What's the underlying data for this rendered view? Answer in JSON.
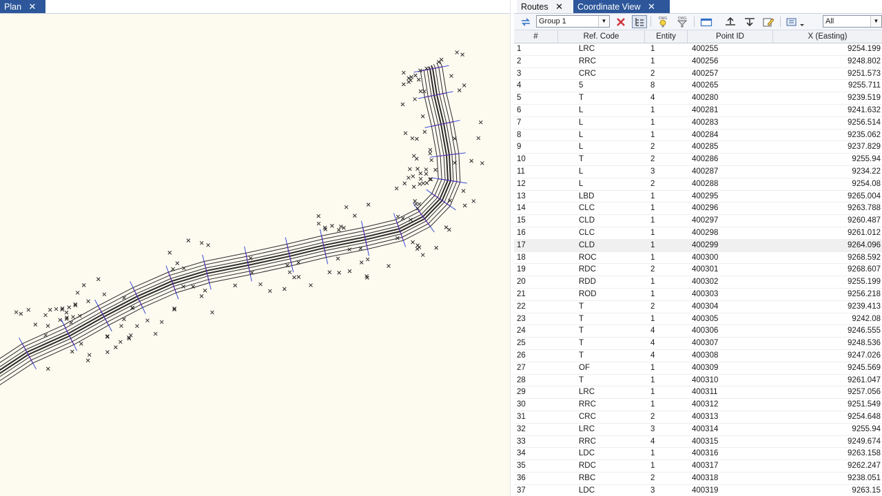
{
  "plan": {
    "tab_label": "Plan",
    "tab_close": "✕"
  },
  "coord": {
    "tabs": [
      {
        "label": "Routes",
        "close": "✕"
      },
      {
        "label": "Coordinate View",
        "close": "✕"
      }
    ],
    "toolbar": {
      "group_value": "Group 1",
      "filter_value": "All",
      "dwg_label": "DWG"
    },
    "columns": [
      "#",
      "Ref. Code",
      "Entity",
      "Point ID",
      "X (Easting)"
    ],
    "rows": [
      [
        "1",
        "LRC",
        "1",
        "400255",
        "9254.199"
      ],
      [
        "2",
        "RRC",
        "1",
        "400256",
        "9248.802"
      ],
      [
        "3",
        "CRC",
        "2",
        "400257",
        "9251.573"
      ],
      [
        "4",
        "5",
        "8",
        "400265",
        "9255.711"
      ],
      [
        "5",
        "T",
        "4",
        "400280",
        "9239.519"
      ],
      [
        "6",
        "L",
        "1",
        "400281",
        "9241.632"
      ],
      [
        "7",
        "L",
        "1",
        "400283",
        "9256.514"
      ],
      [
        "8",
        "L",
        "1",
        "400284",
        "9235.062"
      ],
      [
        "9",
        "L",
        "2",
        "400285",
        "9237.829"
      ],
      [
        "10",
        "T",
        "2",
        "400286",
        "9255.94"
      ],
      [
        "11",
        "L",
        "3",
        "400287",
        "9234.22"
      ],
      [
        "12",
        "L",
        "2",
        "400288",
        "9254.08"
      ],
      [
        "13",
        "LBD",
        "1",
        "400295",
        "9265.004"
      ],
      [
        "14",
        "CLC",
        "1",
        "400296",
        "9263.788"
      ],
      [
        "15",
        "CLD",
        "1",
        "400297",
        "9260.487"
      ],
      [
        "16",
        "CLC",
        "1",
        "400298",
        "9261.012"
      ],
      [
        "17",
        "CLD",
        "1",
        "400299",
        "9264.096"
      ],
      [
        "18",
        "ROC",
        "1",
        "400300",
        "9268.592"
      ],
      [
        "19",
        "RDC",
        "2",
        "400301",
        "9268.607"
      ],
      [
        "20",
        "RDD",
        "1",
        "400302",
        "9255.199"
      ],
      [
        "21",
        "ROD",
        "1",
        "400303",
        "9256.218"
      ],
      [
        "22",
        "T",
        "2",
        "400304",
        "9239.413"
      ],
      [
        "23",
        "T",
        "1",
        "400305",
        "9242.08"
      ],
      [
        "24",
        "T",
        "4",
        "400306",
        "9246.555"
      ],
      [
        "25",
        "T",
        "4",
        "400307",
        "9248.536"
      ],
      [
        "26",
        "T",
        "4",
        "400308",
        "9247.026"
      ],
      [
        "27",
        "OF",
        "1",
        "400309",
        "9245.569"
      ],
      [
        "28",
        "T",
        "1",
        "400310",
        "9261.047"
      ],
      [
        "29",
        "LRC",
        "1",
        "400311",
        "9257.056"
      ],
      [
        "30",
        "RRC",
        "1",
        "400312",
        "9251.549"
      ],
      [
        "31",
        "CRC",
        "2",
        "400313",
        "9254.648"
      ],
      [
        "32",
        "LRC",
        "3",
        "400314",
        "9255.94"
      ],
      [
        "33",
        "RRC",
        "4",
        "400315",
        "9249.674"
      ],
      [
        "34",
        "LDC",
        "1",
        "400316",
        "9263.158"
      ],
      [
        "35",
        "RDC",
        "1",
        "400317",
        "9262.247"
      ],
      [
        "36",
        "RBC",
        "2",
        "400318",
        "9238.051"
      ],
      [
        "37",
        "LDC",
        "3",
        "400319",
        "9263.15"
      ]
    ],
    "selected_row": 17
  },
  "colors": {
    "tab_active": "#2d579a",
    "section_red": "#d2184b",
    "section_blue": "#2136cf",
    "plan_background": "#fdfaf0"
  }
}
